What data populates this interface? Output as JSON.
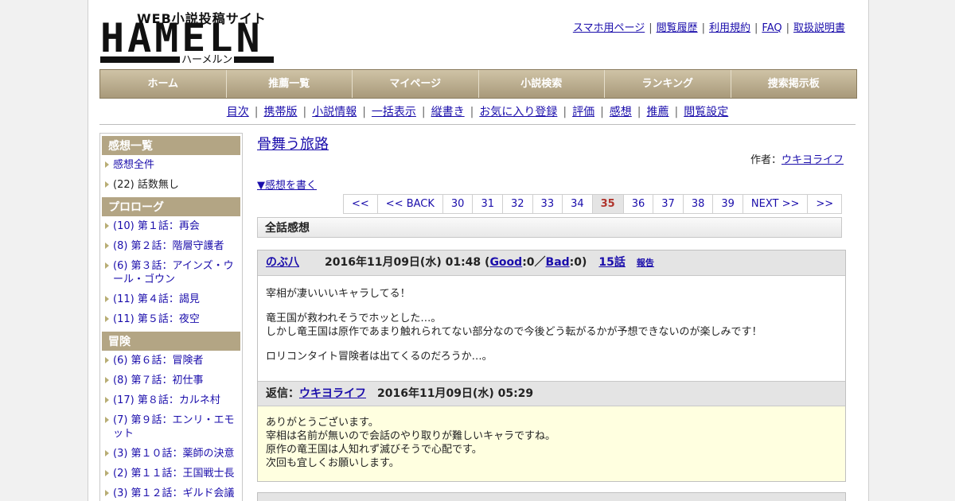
{
  "header": {
    "logo_top": "WEB小説投稿サイト",
    "logo_main": "HAMELN",
    "logo_sub": "ハーメルン",
    "top_links": [
      "スマホ用ページ",
      "閲覧履歴",
      "利用規約",
      "FAQ",
      "取扱説明書"
    ]
  },
  "nav": [
    "ホーム",
    "推薦一覧",
    "マイページ",
    "小説検索",
    "ランキング",
    "捜索掲示板"
  ],
  "subnav": [
    "目次",
    "携帯版",
    "小説情報",
    "一括表示",
    "縦書き",
    "お気に入り登録",
    "評価",
    "感想",
    "推薦",
    "閲覧設定"
  ],
  "sidebar": {
    "sections": [
      {
        "title": "感想一覧",
        "items": [
          {
            "label": "感想全件",
            "link": true
          },
          {
            "label": "(22) 話数無し",
            "link": false
          }
        ]
      },
      {
        "title": "プロローグ",
        "items": [
          {
            "label": "(10) 第１話：再会",
            "link": true
          },
          {
            "label": "(8) 第２話：階層守護者",
            "link": true
          },
          {
            "label": "(6) 第３話：アインズ・ウール・ゴウン",
            "link": true
          },
          {
            "label": "(11) 第４話：謁見",
            "link": true
          },
          {
            "label": "(11) 第５話：夜空",
            "link": true
          }
        ]
      },
      {
        "title": "冒険",
        "items": [
          {
            "label": "(6) 第６話：冒険者",
            "link": true
          },
          {
            "label": "(8) 第７話：初仕事",
            "link": true
          },
          {
            "label": "(17) 第８話：カルネ村",
            "link": true
          },
          {
            "label": "(7) 第９話：エンリ・エモット",
            "link": true
          },
          {
            "label": "(3) 第１０話：薬師の決意",
            "link": true
          },
          {
            "label": "(2) 第１１話：王国戦士長",
            "link": true
          },
          {
            "label": "(3) 第１２話：ギルド会議",
            "link": true
          }
        ]
      }
    ]
  },
  "main": {
    "title": "骨舞う旅路",
    "author_label": "作者：",
    "author": "ウキヨライフ",
    "write_link": "▼感想を書く",
    "pager": [
      "<<",
      "<< BACK",
      "30",
      "31",
      "32",
      "33",
      "34",
      "35",
      "36",
      "37",
      "38",
      "39",
      "NEXT >>",
      ">>"
    ],
    "pager_current": "35",
    "section_title": "全話感想",
    "comments": [
      {
        "user": "のぶ八",
        "date_open": "2016年11月09日(水) 01:48 (",
        "good_label": "Good",
        "good_count": ":0／",
        "bad_label": "Bad",
        "bad_count": ":0)",
        "episode": "15話",
        "report": "報告",
        "body": [
          "宰相が凄いいいキャラしてる！",
          "竜王国が救われそうでホッとした…。",
          "しかし竜王国は原作であまり触れられてない部分なので今後どう転がるかが予想できないのが楽しみです！",
          "ロリコンタイト冒険者は出てくるのだろうか…。"
        ],
        "reply_label": "返信：",
        "reply_user": "ウキヨライフ",
        "reply_date": "2016年11月09日(水) 05:29",
        "reply_body": [
          "ありがとうございます。",
          "宰相は名前が無いので会話のやり取りが難しいキャラですね。",
          "原作の竜王国は人知れず滅びそうで心配です。",
          "次回も宜しくお願いします。"
        ]
      }
    ]
  }
}
